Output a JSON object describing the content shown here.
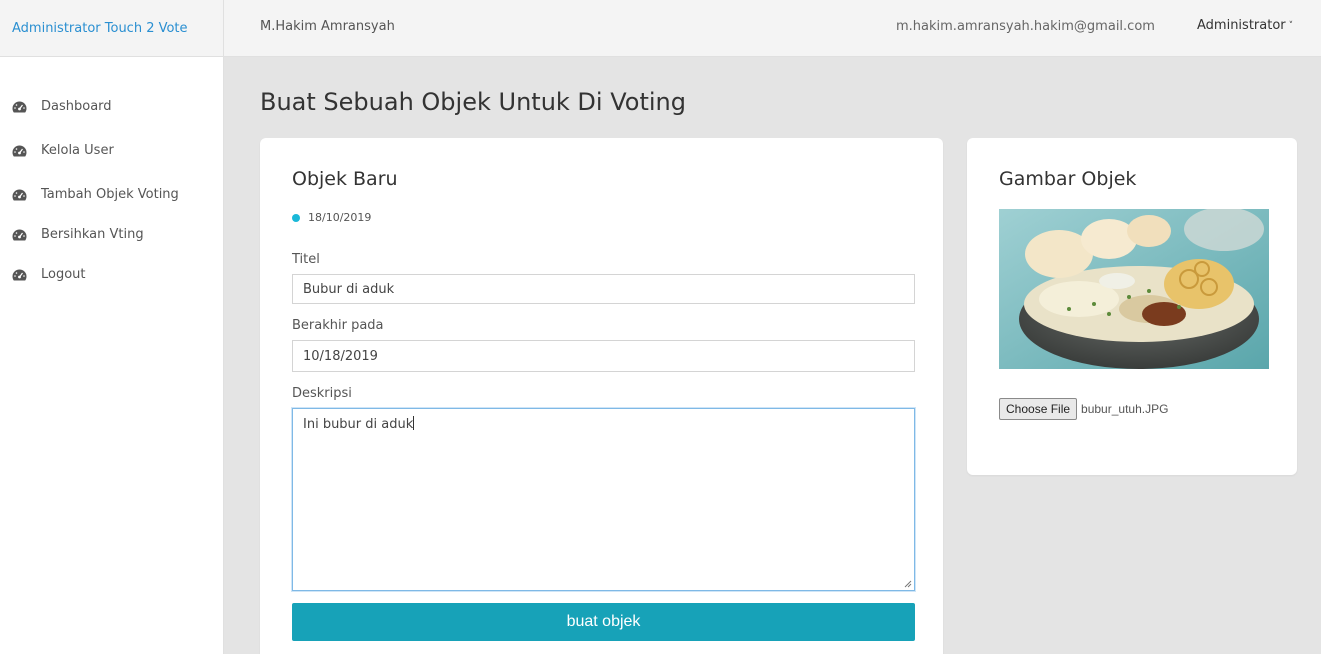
{
  "brand": {
    "title": "Administrator Touch 2 Vote"
  },
  "topbar": {
    "username": "M.Hakim Amransyah",
    "email": "m.hakim.amransyah.hakim@gmail.com",
    "role": "Administrator",
    "role_caret": "˅"
  },
  "sidebar": {
    "items": [
      {
        "label": "Dashboard",
        "icon": "dashboard-icon"
      },
      {
        "label": "Kelola User",
        "icon": "dashboard-icon"
      },
      {
        "label": "Tambah Objek Voting",
        "icon": "dashboard-icon"
      },
      {
        "label": "Bersihkan Vting",
        "icon": "dashboard-icon"
      },
      {
        "label": "Logout",
        "icon": "dashboard-icon"
      }
    ]
  },
  "page": {
    "title": "Buat Sebuah Objek Untuk Di Voting"
  },
  "form": {
    "title": "Objek Baru",
    "date": "18/10/2019",
    "fields": {
      "titel": {
        "label": "Titel",
        "value": "Bubur di aduk"
      },
      "berakhir": {
        "label": "Berakhir pada",
        "value": "10/18/2019"
      },
      "deskripsi": {
        "label": "Deskripsi",
        "value": "Ini bubur di aduk"
      }
    },
    "submit_label": "buat objek"
  },
  "image_panel": {
    "title": "Gambar Objek",
    "image": "bubur-ayam-photo",
    "file_button_label": "Choose File",
    "file_name": "bubur_utuh.JPG"
  },
  "colors": {
    "accent": "#17a2b8",
    "brand_link": "#2a8fd1",
    "status_dot": "#1ab8d8",
    "background": "#e4e4e4"
  }
}
